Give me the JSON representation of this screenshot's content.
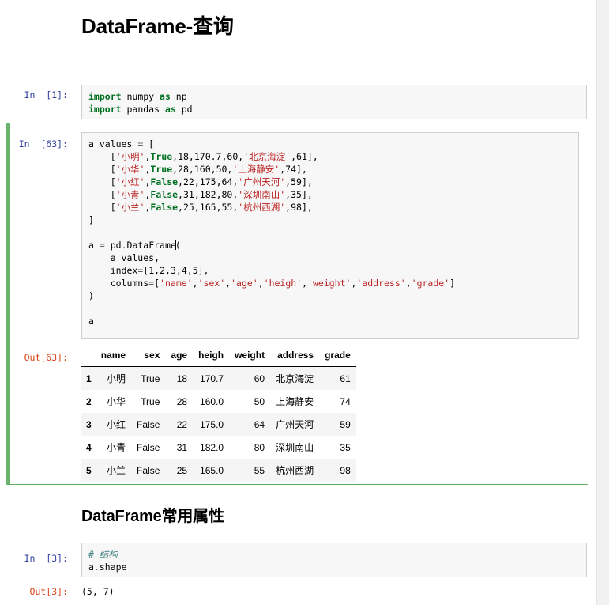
{
  "colors": {
    "keyword": "#007020",
    "string": "#ba2121",
    "comment": "#408080",
    "prompt_in": "#303f9f",
    "prompt_out": "#d84315",
    "selected_cell_border": "#5fae61",
    "code_cell_bg": "#f7f7f7",
    "table_row_alt_bg": "#f5f5f5"
  },
  "headings": {
    "query": "DataFrame-查询",
    "attributes": "DataFrame常用属性"
  },
  "cells": {
    "imports": {
      "prompt": "In  [1]:",
      "lines": [
        [
          {
            "t": "import",
            "c": "k"
          },
          {
            "t": " numpy ",
            "c": "n"
          },
          {
            "t": "as",
            "c": "k"
          },
          {
            "t": " np",
            "c": "n"
          }
        ],
        [
          {
            "t": "import",
            "c": "k"
          },
          {
            "t": " pandas ",
            "c": "n"
          },
          {
            "t": "as",
            "c": "k"
          },
          {
            "t": " pd",
            "c": "n"
          }
        ]
      ]
    },
    "dataframe_build": {
      "prompt": "In  [63]:",
      "lines": [
        [
          {
            "t": "a_values ",
            "c": "n"
          },
          {
            "t": "= ",
            "c": "o"
          },
          {
            "t": "[",
            "c": "n"
          }
        ],
        [
          {
            "t": "    [",
            "c": "n"
          },
          {
            "t": "'小明'",
            "c": "s"
          },
          {
            "t": ",",
            "c": "n"
          },
          {
            "t": "True",
            "c": "kc"
          },
          {
            "t": ",",
            "c": "n"
          },
          {
            "t": "18",
            "c": "mi"
          },
          {
            "t": ",",
            "c": "n"
          },
          {
            "t": "170.7",
            "c": "mi"
          },
          {
            "t": ",",
            "c": "n"
          },
          {
            "t": "60",
            "c": "mi"
          },
          {
            "t": ",",
            "c": "n"
          },
          {
            "t": "'北京海淀'",
            "c": "s"
          },
          {
            "t": ",",
            "c": "n"
          },
          {
            "t": "61",
            "c": "mi"
          },
          {
            "t": "],",
            "c": "n"
          }
        ],
        [
          {
            "t": "    [",
            "c": "n"
          },
          {
            "t": "'小华'",
            "c": "s"
          },
          {
            "t": ",",
            "c": "n"
          },
          {
            "t": "True",
            "c": "kc"
          },
          {
            "t": ",",
            "c": "n"
          },
          {
            "t": "28",
            "c": "mi"
          },
          {
            "t": ",",
            "c": "n"
          },
          {
            "t": "160",
            "c": "mi"
          },
          {
            "t": ",",
            "c": "n"
          },
          {
            "t": "50",
            "c": "mi"
          },
          {
            "t": ",",
            "c": "n"
          },
          {
            "t": "'上海静安'",
            "c": "s"
          },
          {
            "t": ",",
            "c": "n"
          },
          {
            "t": "74",
            "c": "mi"
          },
          {
            "t": "],",
            "c": "n"
          }
        ],
        [
          {
            "t": "    [",
            "c": "n"
          },
          {
            "t": "'小红'",
            "c": "s"
          },
          {
            "t": ",",
            "c": "n"
          },
          {
            "t": "False",
            "c": "kc"
          },
          {
            "t": ",",
            "c": "n"
          },
          {
            "t": "22",
            "c": "mi"
          },
          {
            "t": ",",
            "c": "n"
          },
          {
            "t": "175",
            "c": "mi"
          },
          {
            "t": ",",
            "c": "n"
          },
          {
            "t": "64",
            "c": "mi"
          },
          {
            "t": ",",
            "c": "n"
          },
          {
            "t": "'广州天河'",
            "c": "s"
          },
          {
            "t": ",",
            "c": "n"
          },
          {
            "t": "59",
            "c": "mi"
          },
          {
            "t": "],",
            "c": "n"
          }
        ],
        [
          {
            "t": "    [",
            "c": "n"
          },
          {
            "t": "'小青'",
            "c": "s"
          },
          {
            "t": ",",
            "c": "n"
          },
          {
            "t": "False",
            "c": "kc"
          },
          {
            "t": ",",
            "c": "n"
          },
          {
            "t": "31",
            "c": "mi"
          },
          {
            "t": ",",
            "c": "n"
          },
          {
            "t": "182",
            "c": "mi"
          },
          {
            "t": ",",
            "c": "n"
          },
          {
            "t": "80",
            "c": "mi"
          },
          {
            "t": ",",
            "c": "n"
          },
          {
            "t": "'深圳南山'",
            "c": "s"
          },
          {
            "t": ",",
            "c": "n"
          },
          {
            "t": "35",
            "c": "mi"
          },
          {
            "t": "],",
            "c": "n"
          }
        ],
        [
          {
            "t": "    [",
            "c": "n"
          },
          {
            "t": "'小兰'",
            "c": "s"
          },
          {
            "t": ",",
            "c": "n"
          },
          {
            "t": "False",
            "c": "kc"
          },
          {
            "t": ",",
            "c": "n"
          },
          {
            "t": "25",
            "c": "mi"
          },
          {
            "t": ",",
            "c": "n"
          },
          {
            "t": "165",
            "c": "mi"
          },
          {
            "t": ",",
            "c": "n"
          },
          {
            "t": "55",
            "c": "mi"
          },
          {
            "t": ",",
            "c": "n"
          },
          {
            "t": "'杭州西湖'",
            "c": "s"
          },
          {
            "t": ",",
            "c": "n"
          },
          {
            "t": "98",
            "c": "mi"
          },
          {
            "t": "],",
            "c": "n"
          }
        ],
        [
          {
            "t": "]",
            "c": "n"
          }
        ],
        [
          {
            "t": "",
            "c": "n"
          }
        ],
        [
          {
            "t": "a ",
            "c": "n"
          },
          {
            "t": "= ",
            "c": "o"
          },
          {
            "t": "pd",
            "c": "n"
          },
          {
            "t": ".",
            "c": "o"
          },
          {
            "t": "DataFrame",
            "c": "n"
          },
          {
            "t": "\u0000cursor",
            "c": "cursor"
          },
          {
            "t": "(",
            "c": "n"
          }
        ],
        [
          {
            "t": "    a_values,",
            "c": "n"
          }
        ],
        [
          {
            "t": "    index",
            "c": "n"
          },
          {
            "t": "=",
            "c": "o"
          },
          {
            "t": "[",
            "c": "n"
          },
          {
            "t": "1",
            "c": "mi"
          },
          {
            "t": ",",
            "c": "n"
          },
          {
            "t": "2",
            "c": "mi"
          },
          {
            "t": ",",
            "c": "n"
          },
          {
            "t": "3",
            "c": "mi"
          },
          {
            "t": ",",
            "c": "n"
          },
          {
            "t": "4",
            "c": "mi"
          },
          {
            "t": ",",
            "c": "n"
          },
          {
            "t": "5",
            "c": "mi"
          },
          {
            "t": "],",
            "c": "n"
          }
        ],
        [
          {
            "t": "    columns",
            "c": "n"
          },
          {
            "t": "=",
            "c": "o"
          },
          {
            "t": "[",
            "c": "n"
          },
          {
            "t": "'name'",
            "c": "s"
          },
          {
            "t": ",",
            "c": "n"
          },
          {
            "t": "'sex'",
            "c": "s"
          },
          {
            "t": ",",
            "c": "n"
          },
          {
            "t": "'age'",
            "c": "s"
          },
          {
            "t": ",",
            "c": "n"
          },
          {
            "t": "'heigh'",
            "c": "s"
          },
          {
            "t": ",",
            "c": "n"
          },
          {
            "t": "'weight'",
            "c": "s"
          },
          {
            "t": ",",
            "c": "n"
          },
          {
            "t": "'address'",
            "c": "s"
          },
          {
            "t": ",",
            "c": "n"
          },
          {
            "t": "'grade'",
            "c": "s"
          },
          {
            "t": "]",
            "c": "n"
          }
        ],
        [
          {
            "t": ")",
            "c": "n"
          }
        ],
        [
          {
            "t": "",
            "c": "n"
          }
        ],
        [
          {
            "t": "a",
            "c": "n"
          }
        ]
      ],
      "out_prompt": "Out[63]:"
    },
    "shape": {
      "prompt": "In  [3]:",
      "lines": [
        [
          {
            "t": "# 结构",
            "c": "c"
          }
        ],
        [
          {
            "t": "a",
            "c": "n"
          },
          {
            "t": ".",
            "c": "o"
          },
          {
            "t": "shape",
            "c": "n"
          }
        ]
      ],
      "out_prompt": "Out[3]:",
      "out_text": "(5, 7)"
    }
  },
  "dataframe_output": {
    "index_header": "",
    "columns": [
      "name",
      "sex",
      "age",
      "heigh",
      "weight",
      "address",
      "grade"
    ],
    "index": [
      "1",
      "2",
      "3",
      "4",
      "5"
    ],
    "rows": [
      [
        "小明",
        "True",
        "18",
        "170.7",
        "60",
        "北京海淀",
        "61"
      ],
      [
        "小华",
        "True",
        "28",
        "160.0",
        "50",
        "上海静安",
        "74"
      ],
      [
        "小红",
        "False",
        "22",
        "175.0",
        "64",
        "广州天河",
        "59"
      ],
      [
        "小青",
        "False",
        "31",
        "182.0",
        "80",
        "深圳南山",
        "35"
      ],
      [
        "小兰",
        "False",
        "25",
        "165.0",
        "55",
        "杭州西湖",
        "98"
      ]
    ]
  }
}
